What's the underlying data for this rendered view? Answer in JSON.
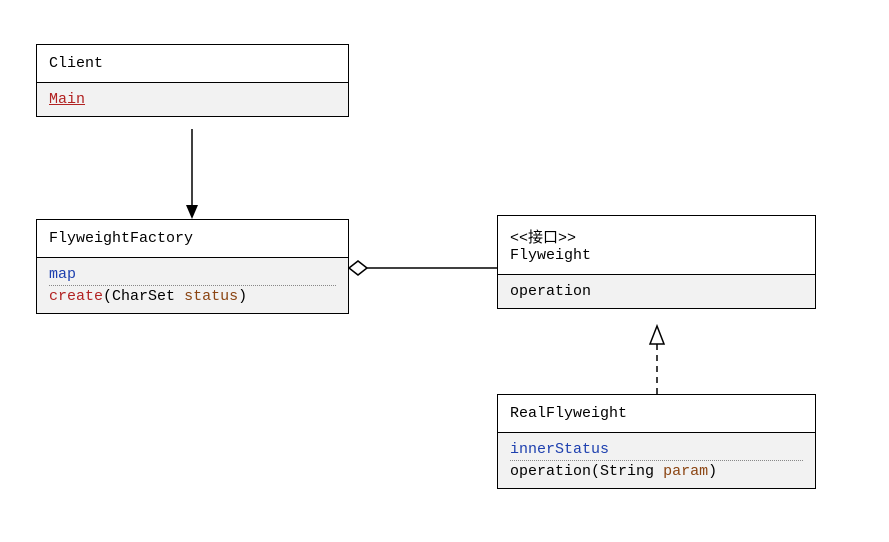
{
  "classes": {
    "client": {
      "name": "Client",
      "members": [
        {
          "kind": "method",
          "name": "Main",
          "static": true
        }
      ]
    },
    "factory": {
      "name": "FlyweightFactory",
      "members": [
        {
          "kind": "attr",
          "name": "map"
        },
        {
          "kind": "method",
          "name": "create",
          "paramType": "CharSet",
          "paramName": "status"
        }
      ]
    },
    "flyweight": {
      "stereotype": "<<接口>>",
      "name": "Flyweight",
      "members": [
        {
          "kind": "method",
          "name": "operation"
        }
      ]
    },
    "real": {
      "name": "RealFlyweight",
      "members": [
        {
          "kind": "attr",
          "name": "innerStatus"
        },
        {
          "kind": "method",
          "name": "operation",
          "paramType": "String",
          "paramName": "param"
        }
      ]
    }
  }
}
